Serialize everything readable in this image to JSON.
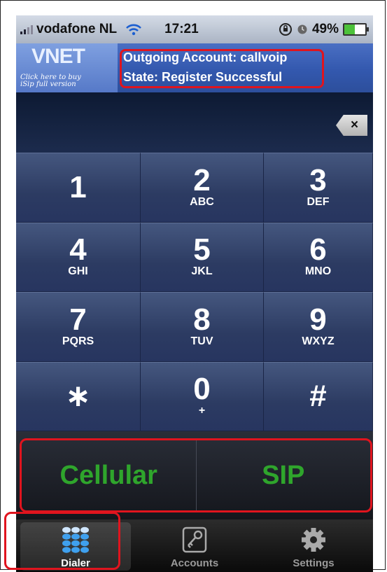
{
  "status_bar": {
    "carrier": "vodafone NL",
    "time": "17:21",
    "battery": "49%",
    "battery_level": 0.49,
    "icons": [
      "signal-bars-icon",
      "wifi-icon",
      "rotation-lock-icon",
      "alarm-icon",
      "battery-icon"
    ]
  },
  "header": {
    "logo": "VNET",
    "logo_sub_line1": "Click here to buy",
    "logo_sub_line2": "iSip full version",
    "outgoing_account": "Outgoing Account: callvoip",
    "state": "State: Register Successful"
  },
  "display": {
    "number": "",
    "backspace_symbol": "×"
  },
  "keypad": [
    {
      "digit": "1",
      "letters": ""
    },
    {
      "digit": "2",
      "letters": "ABC"
    },
    {
      "digit": "3",
      "letters": "DEF"
    },
    {
      "digit": "4",
      "letters": "GHI"
    },
    {
      "digit": "5",
      "letters": "JKL"
    },
    {
      "digit": "6",
      "letters": "MNO"
    },
    {
      "digit": "7",
      "letters": "PQRS"
    },
    {
      "digit": "8",
      "letters": "TUV"
    },
    {
      "digit": "9",
      "letters": "WXYZ"
    },
    {
      "digit": "∗",
      "letters": ""
    },
    {
      "digit": "0",
      "letters": "+"
    },
    {
      "digit": "#",
      "letters": ""
    }
  ],
  "call_buttons": {
    "cellular": "Cellular",
    "sip": "SIP"
  },
  "tabs": [
    {
      "label": "Dialer",
      "icon": "dialpad-icon"
    },
    {
      "label": "Accounts",
      "icon": "key-icon"
    },
    {
      "label": "Settings",
      "icon": "gear-icon"
    }
  ],
  "colors": {
    "highlight": "#e0141e",
    "call_text": "#2fa52c",
    "header": "#3358ae"
  }
}
